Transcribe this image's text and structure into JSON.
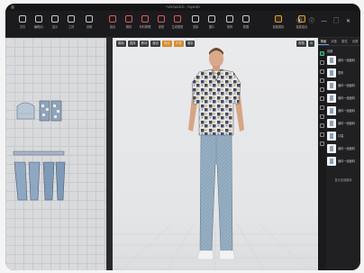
{
  "titlebar": {
    "title": "*UNSAVED - Style3D"
  },
  "toolbar": {
    "tools": [
      {
        "label": "文件",
        "icon": "file-icon",
        "color": "white"
      },
      {
        "label": "编辑(E)",
        "icon": "edit-icon",
        "color": "white"
      },
      {
        "label": "显示",
        "icon": "display-icon",
        "color": "white"
      },
      {
        "label": "工具",
        "icon": "tool-icon",
        "color": "white"
      },
      {
        "label": "设置",
        "icon": "settings-icon",
        "color": "white"
      },
      {
        "label": "缝合",
        "icon": "sew-icon",
        "color": "red"
      },
      {
        "label": "模拟",
        "icon": "simulate-icon",
        "color": "red"
      },
      {
        "label": "布料物理",
        "icon": "physics-icon",
        "color": "red"
      },
      {
        "label": "原型",
        "icon": "prototype-icon",
        "color": "red"
      },
      {
        "label": "生成模型",
        "icon": "generate-icon",
        "color": "red"
      },
      {
        "label": "渲染",
        "icon": "render-icon",
        "color": "white"
      },
      {
        "label": "图片",
        "icon": "image-icon",
        "color": "white"
      },
      {
        "label": "放码",
        "icon": "grading-icon",
        "color": "white"
      },
      {
        "label": "数据",
        "icon": "data-icon",
        "color": "white"
      },
      {
        "label": "智能模拟",
        "icon": "ai-sim-icon",
        "color": "orange"
      },
      {
        "label": "智能缝合",
        "icon": "ai-sew-icon",
        "color": "orange"
      }
    ],
    "window_controls": "⦿ ⓘ — ▢ ✕"
  },
  "viewport": {
    "left_tools": [
      "模拟",
      "选择",
      "移动",
      "缝合",
      "固定",
      "折叠",
      "渲染"
    ],
    "right_tools": [
      "视角",
      "⚙"
    ]
  },
  "right_panel": {
    "tabs": [
      "场景",
      "对象",
      "属性",
      "设置"
    ],
    "section": "设置",
    "items": [
      "面料一组面料",
      "里布",
      "面料一组面料",
      "面料一组面料",
      "面料一组面料",
      "面料一组面料",
      "口袋",
      "面料一组面料",
      "面料一组面料"
    ],
    "footer": "显示全部面料"
  }
}
